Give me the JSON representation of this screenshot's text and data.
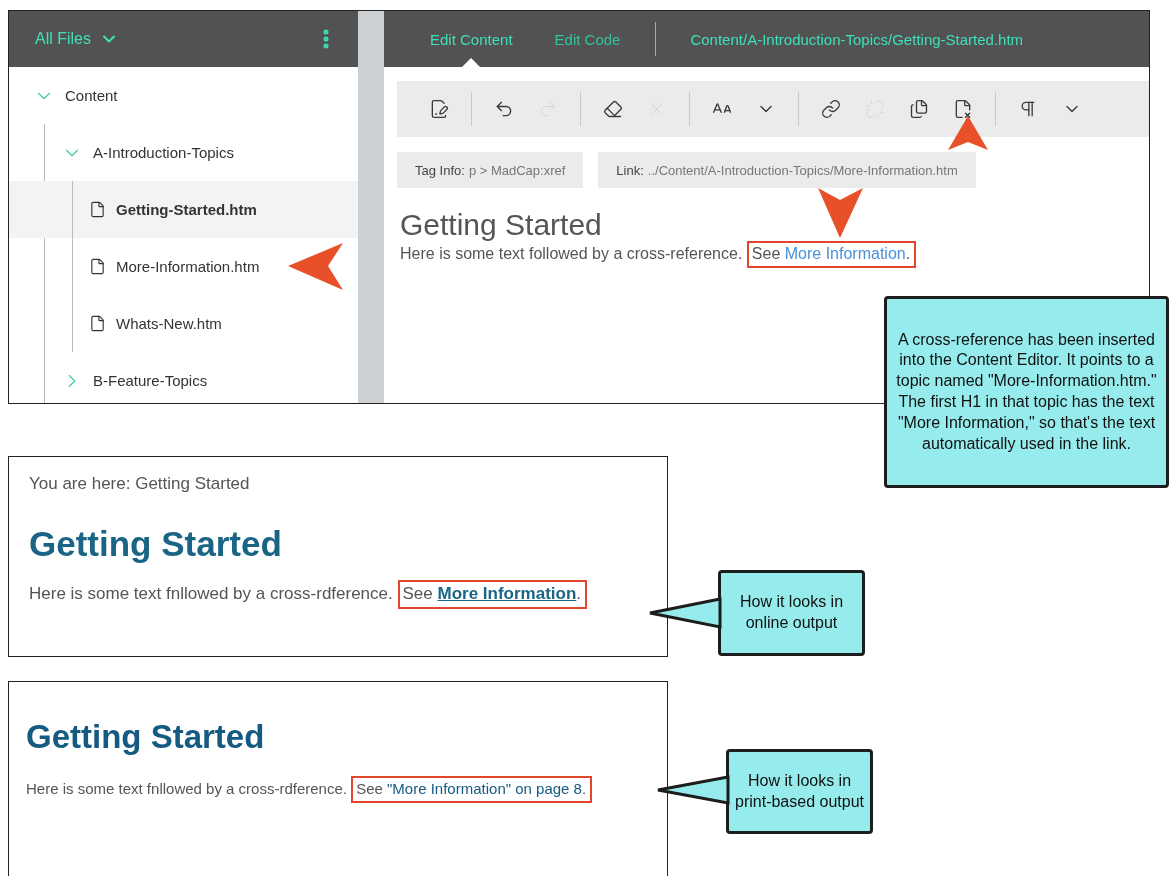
{
  "file_panel": {
    "title": "All Files",
    "tree": [
      {
        "label": "Content",
        "expanded": true,
        "children": [
          {
            "label": "A-Introduction-Topics",
            "expanded": true,
            "children": [
              {
                "label": "Getting-Started.htm",
                "selected": true
              },
              {
                "label": "More-Information.htm",
                "selected": false
              },
              {
                "label": "Whats-New.htm",
                "selected": false
              }
            ]
          },
          {
            "label": "B-Feature-Topics",
            "expanded": false
          }
        ]
      }
    ]
  },
  "editor": {
    "tabs": [
      {
        "label": "Edit Content",
        "selected": true
      },
      {
        "label": "Edit Code",
        "selected": false
      }
    ],
    "path": "Content/A-Introduction-Topics/Getting-Started.htm",
    "toolbar": [
      {
        "kind": "edit",
        "disabled": false
      },
      {
        "kind": "separator"
      },
      {
        "kind": "undo",
        "disabled": false
      },
      {
        "kind": "redo",
        "disabled": true
      },
      {
        "kind": "separator"
      },
      {
        "kind": "eraser",
        "disabled": false
      },
      {
        "kind": "delete",
        "disabled": true
      },
      {
        "kind": "separator"
      },
      {
        "kind": "font-size",
        "disabled": false
      },
      {
        "kind": "dropdown",
        "disabled": false
      },
      {
        "kind": "separator"
      },
      {
        "kind": "link",
        "disabled": false
      },
      {
        "kind": "unlink",
        "disabled": true
      },
      {
        "kind": "cross-reference",
        "disabled": false
      },
      {
        "kind": "remove-cross-reference",
        "disabled": false
      },
      {
        "kind": "separator"
      },
      {
        "kind": "paragraph",
        "disabled": false
      },
      {
        "kind": "dropdown",
        "disabled": false
      }
    ],
    "tag_info": {
      "label": "Tag Info:",
      "value": "p > MadCap:xref"
    },
    "link_info": {
      "label": "Link:",
      "value": "../Content/A-Introduction-Topics/More-Information.htm"
    },
    "heading": "Getting Started",
    "paragraph": {
      "text": "Here is some text followed by a cross-reference.",
      "prefix": "See",
      "link": "More Information",
      "suffix": "."
    }
  },
  "online_output": {
    "breadcrumb": "You are here: Getting Started",
    "heading": "Getting Started",
    "paragraph": {
      "text": "Here is some text fnllowed by a cross-rdference.",
      "prefix": "See",
      "link": "More Information",
      "suffix": "."
    }
  },
  "print_output": {
    "heading": "Getting Started",
    "paragraph": {
      "text": "Here is some text fnllowed by a cross-rdference.",
      "prefix": "See",
      "link": "\"More Information\" on page 8",
      "suffix": "."
    }
  },
  "callouts": [
    {
      "text": "A cross-reference has been inserted into the Content Editor. It points to a topic named \"More-Information.htm.\" The first H1 in that topic has the text \"More Information,\" so that's the text automatically used in the link."
    },
    {
      "text": "How it looks in online output"
    },
    {
      "text": "How it looks in print-based output"
    }
  ]
}
